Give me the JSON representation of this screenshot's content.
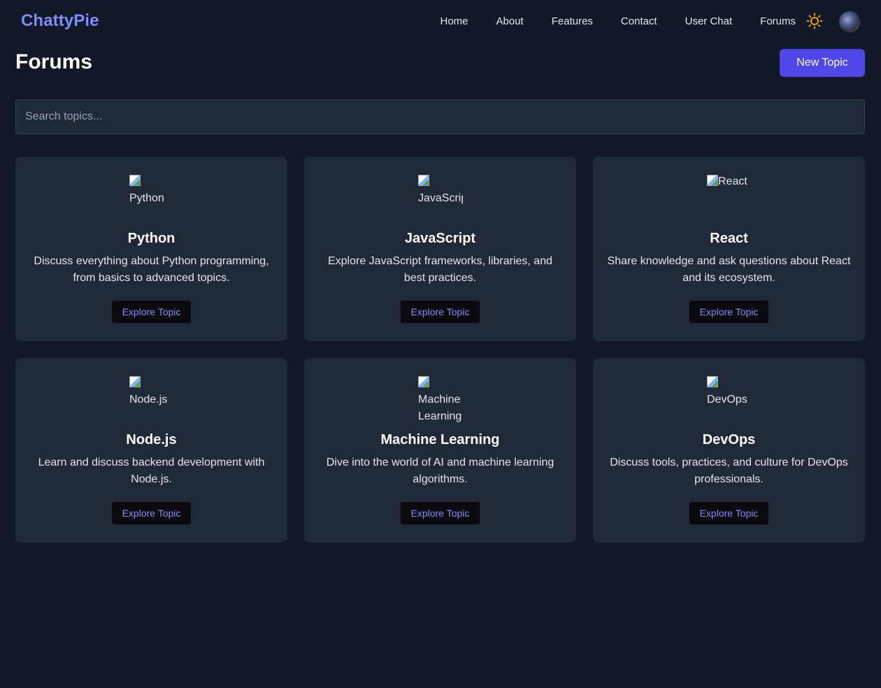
{
  "nav": {
    "brand": "ChattyPie",
    "links": [
      "Home",
      "About",
      "Features",
      "Contact",
      "User Chat",
      "Forums"
    ]
  },
  "page": {
    "title": "Forums",
    "new_topic_label": "New Topic"
  },
  "search": {
    "placeholder": "Search topics..."
  },
  "colors": {
    "background": "#111827",
    "card": "#1f2937",
    "accent": "#4f46e5",
    "brand": "#818cf8",
    "sun": "#f59e0b"
  },
  "topics": [
    {
      "alt_lines": [
        "Python"
      ],
      "title": "Python",
      "description": "Discuss everything about Python programming, from basics to advanced topics.",
      "button": "Explore Topic"
    },
    {
      "alt_lines": [
        "JavaScript"
      ],
      "title": "JavaScript",
      "description": "Explore JavaScript frameworks, libraries, and best practices.",
      "button": "Explore Topic"
    },
    {
      "alt_lines": [
        "React"
      ],
      "title": "React",
      "description": "Share knowledge and ask questions about React and its ecosystem.",
      "button": "Explore Topic"
    },
    {
      "alt_lines": [
        "Node.js"
      ],
      "title": "Node.js",
      "description": "Learn and discuss backend development with Node.js.",
      "button": "Explore Topic"
    },
    {
      "alt_lines": [
        "Machine",
        "Learning"
      ],
      "title": "Machine Learning",
      "description": "Dive into the world of AI and machine learning algorithms.",
      "button": "Explore Topic"
    },
    {
      "alt_lines": [
        "DevOps"
      ],
      "title": "DevOps",
      "description": "Discuss tools, practices, and culture for DevOps professionals.",
      "button": "Explore Topic"
    }
  ]
}
